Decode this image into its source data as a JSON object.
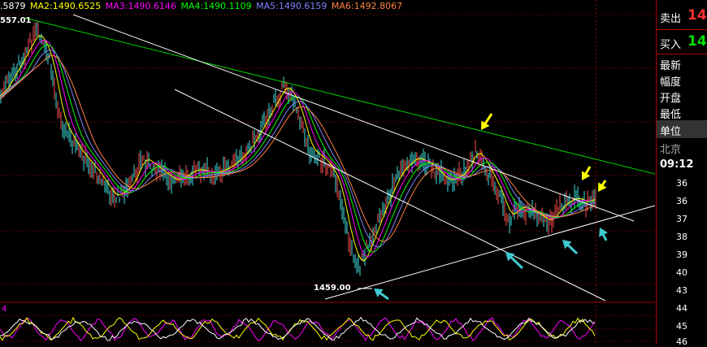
{
  "header": {
    "ma1": ".5879",
    "ma2": "MA2:1490.6525",
    "ma3": "MA3:1490.6146",
    "ma4": "MA4:1490.1109",
    "ma5": "MA5:1490.6159",
    "ma6": "MA6:1492.8067",
    "colors": {
      "ma1": "#ffffff",
      "ma2": "#ffff00",
      "ma3": "#ff00ff",
      "ma4": "#00ff00",
      "ma5": "#8080ff",
      "ma6": "#ff8040"
    }
  },
  "annotations": {
    "high_label": "557.01",
    "low_label": "1459.00",
    "lower_panel_value": "4"
  },
  "side_panel": {
    "sell_label": "卖出",
    "sell_value": "14",
    "buy_label": "买入",
    "buy_value": "14",
    "fields": [
      "最新",
      "幅度",
      "开盘",
      "最低"
    ],
    "unit_label": "单位",
    "location": "北京",
    "time": "09:12",
    "ticks": [
      "36",
      "36",
      "37",
      "38",
      "39",
      "40",
      "43",
      "44",
      "45",
      "46"
    ]
  },
  "colors": {
    "sell": "#ff3030",
    "buy": "#00e000",
    "trendline_green": "#00d000",
    "channel_white": "#ffffff",
    "arrow_yellow": "#ffff00",
    "arrow_cyan": "#40c8d0",
    "grid_red": "#a00000"
  }
}
